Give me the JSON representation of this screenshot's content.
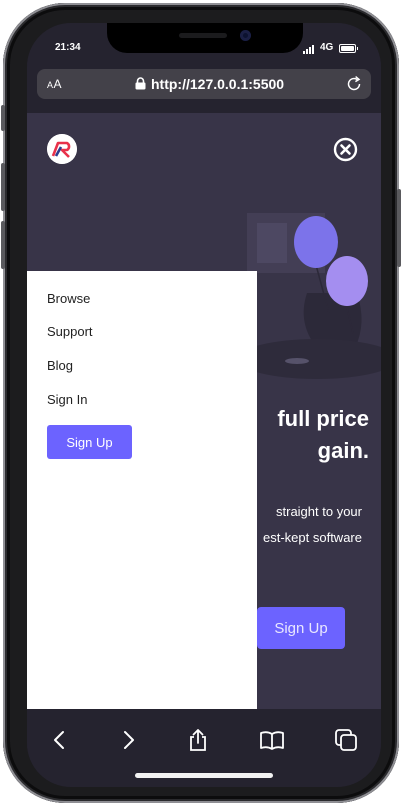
{
  "status_bar": {
    "time": "21:34",
    "network": "4G",
    "battery_level": 1.0
  },
  "browser": {
    "text_size_label_small": "A",
    "text_size_label": "A",
    "url": "http://127.0.0.1:5500"
  },
  "nav": {
    "logo_icon": "brand-logo-icon",
    "close_icon": "close-circle-icon"
  },
  "hero": {
    "title": "full price\ngain.",
    "text": "straight to your\nest-kept software",
    "cta_label": "Sign Up"
  },
  "drawer": {
    "items": [
      {
        "label": "Browse"
      },
      {
        "label": "Support"
      },
      {
        "label": "Blog"
      },
      {
        "label": "Sign In"
      }
    ],
    "cta_label": "Sign Up"
  },
  "colors": {
    "accent": "#6c63ff",
    "page_bg": "#383448",
    "chrome_bg": "#25232f",
    "logo_red": "#e8314a",
    "logo_blue": "#2f3c8e"
  },
  "toolbar": {
    "icons": [
      "back-icon",
      "forward-icon",
      "share-icon",
      "bookmarks-icon",
      "tabs-icon"
    ]
  }
}
